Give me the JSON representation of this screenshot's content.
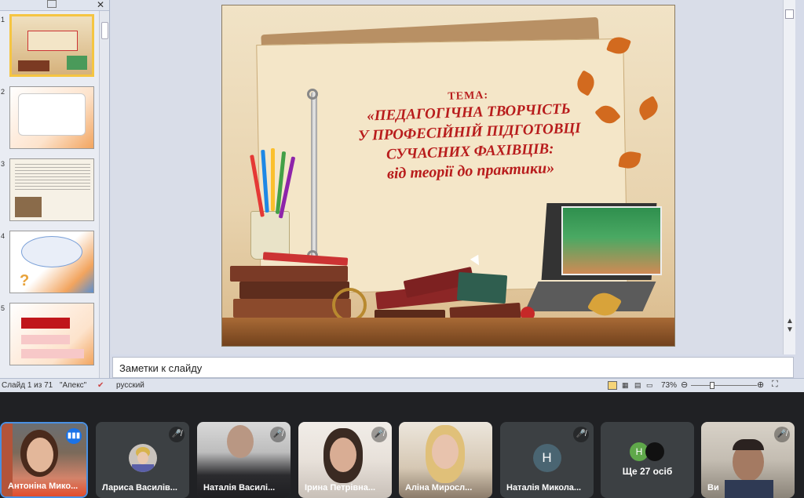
{
  "powerpoint": {
    "thumbnails": [
      {
        "num": "1",
        "selected": true
      },
      {
        "num": "2",
        "selected": false
      },
      {
        "num": "3",
        "selected": false
      },
      {
        "num": "4",
        "selected": false
      },
      {
        "num": "5",
        "selected": false
      }
    ],
    "slide": {
      "tema": "ТЕМА:",
      "lines": [
        "«ПЕДАГОГІЧНА ТВОРЧІСТЬ",
        "У ПРОФЕСІЙНІЙ ПІДГОТОВЦІ",
        "СУЧАСНИХ ФАХІВЦІВ:",
        "від теорії до практики»"
      ]
    },
    "notes_placeholder": "Заметки к слайду",
    "status": {
      "slide_counter": "Слайд 1 из 71",
      "theme": "\"Апекс\"",
      "language": "русский",
      "zoom": "73%"
    }
  },
  "meeting": {
    "participants": [
      {
        "name": "Антоніна Мико...",
        "muted": false,
        "speaking": true,
        "video": true
      },
      {
        "name": "Лариса Василів...",
        "muted": true,
        "video": false
      },
      {
        "name": "Наталія Василі...",
        "muted": true,
        "video": true
      },
      {
        "name": "Ірина Петрівна...",
        "muted": true,
        "video": true
      },
      {
        "name": "Аліна Миросл...",
        "muted": false,
        "video": true
      },
      {
        "name": "Наталія Микола...",
        "muted": true,
        "video": false,
        "initial": "Н"
      },
      {
        "name": "Ви",
        "muted": true,
        "video": true
      }
    ],
    "more": {
      "label": "Ще 27 осіб",
      "initial": "Н"
    }
  }
}
